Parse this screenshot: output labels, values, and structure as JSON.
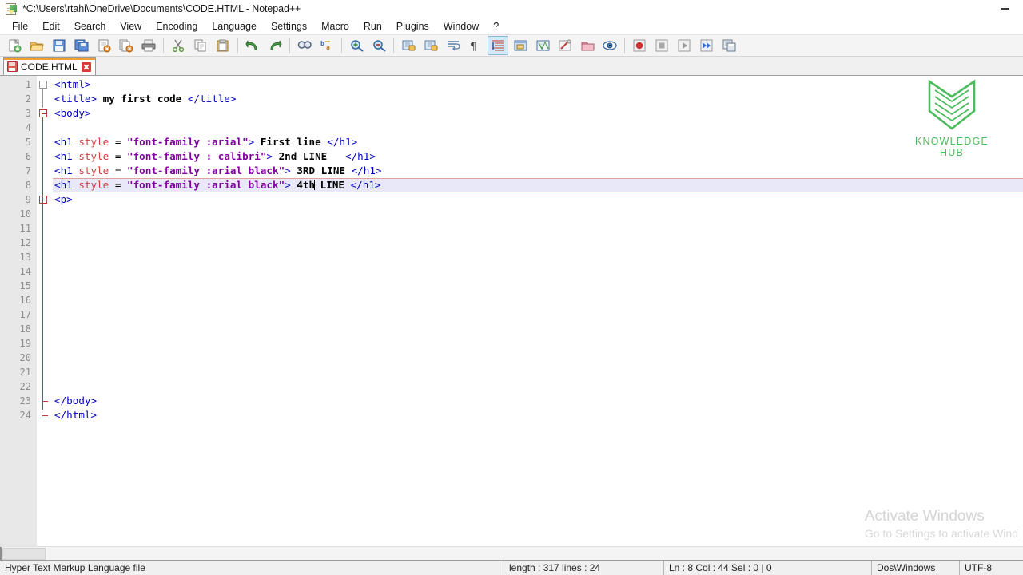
{
  "window": {
    "title": "*C:\\Users\\rtahi\\OneDrive\\Documents\\CODE.HTML - Notepad++",
    "app_icon": "notepad-plus-plus-icon",
    "minimize_label": "–"
  },
  "menubar": {
    "items": [
      {
        "label": "File",
        "name": "menu-file"
      },
      {
        "label": "Edit",
        "name": "menu-edit"
      },
      {
        "label": "Search",
        "name": "menu-search"
      },
      {
        "label": "View",
        "name": "menu-view"
      },
      {
        "label": "Encoding",
        "name": "menu-encoding"
      },
      {
        "label": "Language",
        "name": "menu-language"
      },
      {
        "label": "Settings",
        "name": "menu-settings"
      },
      {
        "label": "Macro",
        "name": "menu-macro"
      },
      {
        "label": "Run",
        "name": "menu-run"
      },
      {
        "label": "Plugins",
        "name": "menu-plugins"
      },
      {
        "label": "Window",
        "name": "menu-window"
      },
      {
        "label": "?",
        "name": "menu-help"
      }
    ]
  },
  "toolbar": {
    "items": [
      {
        "icon": "new-file-icon",
        "title": "New"
      },
      {
        "icon": "open-file-icon",
        "title": "Open"
      },
      {
        "icon": "save-icon",
        "title": "Save"
      },
      {
        "icon": "save-all-icon",
        "title": "Save All"
      },
      {
        "icon": "close-file-icon",
        "title": "Close"
      },
      {
        "icon": "close-all-icon",
        "title": "Close All"
      },
      {
        "icon": "print-icon",
        "title": "Print"
      },
      {
        "icon": "separator",
        "title": ""
      },
      {
        "icon": "cut-icon",
        "title": "Cut"
      },
      {
        "icon": "copy-icon",
        "title": "Copy"
      },
      {
        "icon": "paste-icon",
        "title": "Paste"
      },
      {
        "icon": "separator",
        "title": ""
      },
      {
        "icon": "undo-icon",
        "title": "Undo"
      },
      {
        "icon": "redo-icon",
        "title": "Redo"
      },
      {
        "icon": "separator",
        "title": ""
      },
      {
        "icon": "find-icon",
        "title": "Find"
      },
      {
        "icon": "replace-icon",
        "title": "Replace"
      },
      {
        "icon": "separator",
        "title": ""
      },
      {
        "icon": "zoom-in-icon",
        "title": "Zoom In"
      },
      {
        "icon": "zoom-out-icon",
        "title": "Zoom Out"
      },
      {
        "icon": "separator",
        "title": ""
      },
      {
        "icon": "sync-vertical-scroll-icon",
        "title": "Synchronize Vertical Scrolling"
      },
      {
        "icon": "sync-horizontal-scroll-icon",
        "title": "Synchronize Horizontal Scrolling"
      },
      {
        "icon": "word-wrap-icon",
        "title": "Word wrap"
      },
      {
        "icon": "show-all-characters-icon",
        "title": "Show All Characters"
      },
      {
        "icon": "indent-guide-icon",
        "title": "Show Indent Guide",
        "active": true
      },
      {
        "icon": "user-defined-dialog-icon",
        "title": "User-Defined Dialogue"
      },
      {
        "icon": "document-map-icon",
        "title": "Document Map"
      },
      {
        "icon": "function-list-icon",
        "title": "Function List"
      },
      {
        "icon": "folder-as-workspace-icon",
        "title": "Folder as Workspace"
      },
      {
        "icon": "monitoring-icon",
        "title": "Monitoring"
      },
      {
        "icon": "separator",
        "title": ""
      },
      {
        "icon": "macro-record-icon",
        "title": "Start Recording"
      },
      {
        "icon": "macro-stop-icon",
        "title": "Stop Recording"
      },
      {
        "icon": "macro-play-icon",
        "title": "Playback"
      },
      {
        "icon": "macro-play-multiple-icon",
        "title": "Run a Macro Multiple Times"
      },
      {
        "icon": "macro-save-icon",
        "title": "Save Currently Recorded Macro"
      }
    ]
  },
  "tabs": [
    {
      "label": "CODE.HTML",
      "modified": true,
      "active": true
    }
  ],
  "editor": {
    "total_lines": 24,
    "current_line": 8,
    "lines": [
      {
        "n": 1,
        "fold": "gray-open",
        "tokens": [
          {
            "t": "tag",
            "v": "<html>"
          }
        ]
      },
      {
        "n": 2,
        "fold": "none",
        "tokens": [
          {
            "t": "tag",
            "v": "<title>"
          },
          {
            "t": "txt",
            "v": " my first code "
          },
          {
            "t": "tag",
            "v": "</title>"
          }
        ]
      },
      {
        "n": 3,
        "fold": "red-open",
        "tokens": [
          {
            "t": "tag",
            "v": "<body>"
          }
        ]
      },
      {
        "n": 4,
        "fold": "line",
        "tokens": []
      },
      {
        "n": 5,
        "fold": "line",
        "tokens": [
          {
            "t": "tag",
            "v": "<h1 "
          },
          {
            "t": "attr",
            "v": "style"
          },
          {
            "t": "op",
            "v": " = "
          },
          {
            "t": "val",
            "v": "\"font-family :arial\""
          },
          {
            "t": "tag",
            "v": ">"
          },
          {
            "t": "txt",
            "v": " First line "
          },
          {
            "t": "tag",
            "v": "</h1>"
          }
        ]
      },
      {
        "n": 6,
        "fold": "line",
        "tokens": [
          {
            "t": "tag",
            "v": "<h1 "
          },
          {
            "t": "attr",
            "v": "style"
          },
          {
            "t": "op",
            "v": " = "
          },
          {
            "t": "val",
            "v": "\"font-family : calibri\""
          },
          {
            "t": "tag",
            "v": ">"
          },
          {
            "t": "txt",
            "v": " 2nd LINE   "
          },
          {
            "t": "tag",
            "v": "</h1>"
          }
        ]
      },
      {
        "n": 7,
        "fold": "line",
        "tokens": [
          {
            "t": "tag",
            "v": "<h1 "
          },
          {
            "t": "attr",
            "v": "style"
          },
          {
            "t": "op",
            "v": " = "
          },
          {
            "t": "val",
            "v": "\"font-family :arial black\""
          },
          {
            "t": "tag",
            "v": ">"
          },
          {
            "t": "txt",
            "v": " 3RD LINE "
          },
          {
            "t": "tag",
            "v": "</h1>"
          }
        ]
      },
      {
        "n": 8,
        "fold": "line",
        "tokens": [
          {
            "t": "tag",
            "v": "<h1 "
          },
          {
            "t": "attr",
            "v": "style"
          },
          {
            "t": "op",
            "v": " = "
          },
          {
            "t": "val",
            "v": "\"font-family :arial black\""
          },
          {
            "t": "tag",
            "v": ">"
          },
          {
            "t": "txt",
            "v": " 4th"
          },
          {
            "t": "caret",
            "v": ""
          },
          {
            "t": "txt",
            "v": " LINE "
          },
          {
            "t": "tag",
            "v": "</h1>"
          }
        ]
      },
      {
        "n": 9,
        "fold": "red-open",
        "tokens": [
          {
            "t": "tag",
            "v": "<p>"
          }
        ]
      },
      {
        "n": 10,
        "fold": "line",
        "tokens": []
      },
      {
        "n": 11,
        "fold": "line",
        "tokens": []
      },
      {
        "n": 12,
        "fold": "line",
        "tokens": []
      },
      {
        "n": 13,
        "fold": "line",
        "tokens": []
      },
      {
        "n": 14,
        "fold": "line",
        "tokens": []
      },
      {
        "n": 15,
        "fold": "line",
        "tokens": []
      },
      {
        "n": 16,
        "fold": "line",
        "tokens": []
      },
      {
        "n": 17,
        "fold": "line",
        "tokens": []
      },
      {
        "n": 18,
        "fold": "line",
        "tokens": []
      },
      {
        "n": 19,
        "fold": "line",
        "tokens": []
      },
      {
        "n": 20,
        "fold": "line",
        "tokens": []
      },
      {
        "n": 21,
        "fold": "line",
        "tokens": []
      },
      {
        "n": 22,
        "fold": "line",
        "tokens": []
      },
      {
        "n": 23,
        "fold": "red-end",
        "tokens": [
          {
            "t": "tag",
            "v": "</body>"
          }
        ]
      },
      {
        "n": 24,
        "fold": "red-end-last",
        "tokens": [
          {
            "t": "tag",
            "v": "</html>"
          }
        ]
      }
    ]
  },
  "watermarks": {
    "logo": {
      "line1": "KNOWLEDGE",
      "line2": "HUB",
      "color": "#4cbb5c",
      "icon": "knowledge-hub-book-logo"
    },
    "activate": {
      "line1": "Activate Windows",
      "line2": "Go to Settings to activate Wind"
    }
  },
  "statusbar": {
    "doc_type": "Hyper Text Markup Language file",
    "length_lines": "length : 317   lines : 24",
    "position": "Ln : 8   Col : 44   Sel : 0 | 0",
    "eol": "Dos\\Windows",
    "encoding": "UTF-8"
  },
  "colors": {
    "tag": "#0000c0",
    "attribute": "#d04040",
    "value": "#8000a0",
    "text": "#000000",
    "current_line_bg": "#e8e8f8",
    "fold_red": "#c03a3a",
    "tab_accent": "#f0a030"
  }
}
